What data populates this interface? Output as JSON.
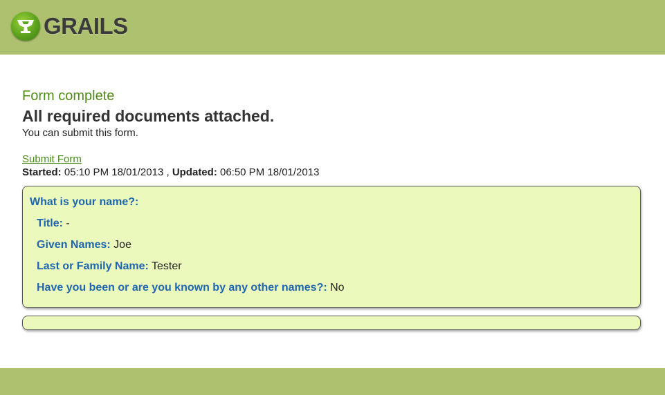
{
  "header": {
    "logo_text": "GRAILS",
    "bg_color": "#aec16f"
  },
  "status": {
    "title": "Form complete",
    "heading": "All required documents attached.",
    "subtext": "You can submit this form."
  },
  "actions": {
    "submit_label": "Submit Form"
  },
  "meta": {
    "started_label": "Started:",
    "started_value": " 05:10 PM 18/01/2013 ",
    "separator": ", ",
    "updated_label": "Updated:",
    "updated_value": " 06:50 PM 18/01/2013"
  },
  "question": {
    "title": "What is your name?:",
    "fields": [
      {
        "label": "Title:",
        "value": " -"
      },
      {
        "label": "Given Names:",
        "value": " Joe"
      },
      {
        "label": "Last or Family Name:",
        "value": " Tester"
      },
      {
        "label": "Have you been or are you known by any other names?:",
        "value": " No"
      }
    ]
  },
  "colors": {
    "accent_green": "#4f8c18",
    "label_blue": "#1e66b0",
    "panel_bg": "#ebf9bd"
  }
}
